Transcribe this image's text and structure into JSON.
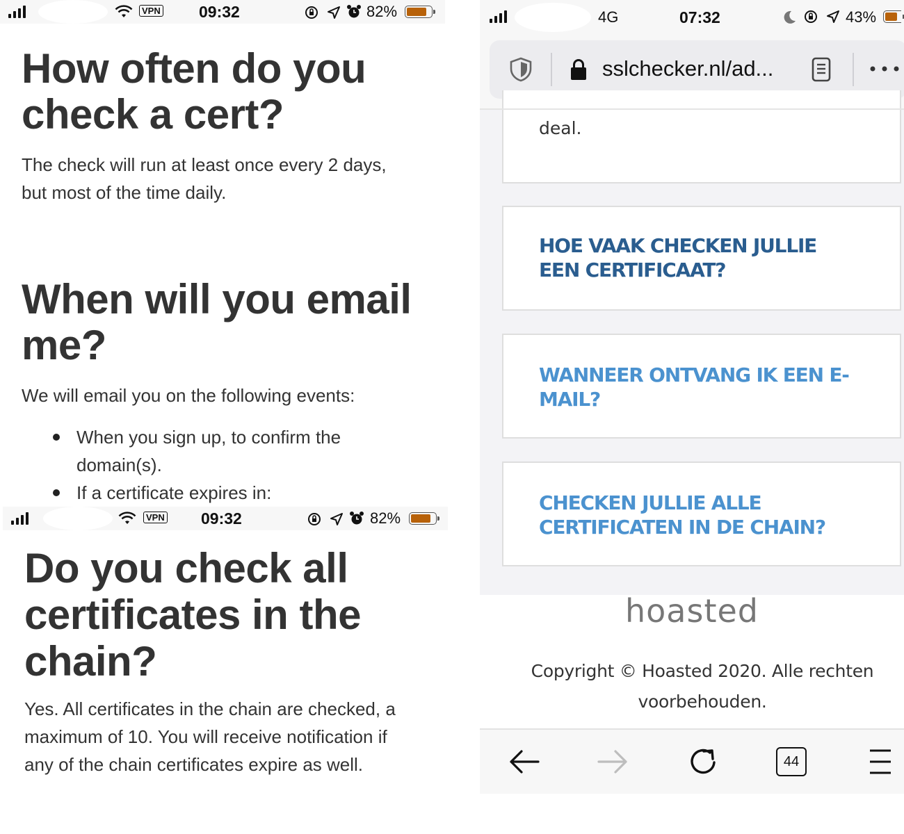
{
  "status_bar_top_left": {
    "time": "09:32",
    "vpn": "VPN",
    "battery": "82%",
    "battery_level": 0.82
  },
  "status_bar_bottom_left": {
    "time": "09:32",
    "vpn": "VPN",
    "battery": "82%",
    "battery_level": 0.82
  },
  "status_bar_right": {
    "network": "4G",
    "time": "07:32",
    "battery": "43%",
    "battery_level": 0.43
  },
  "doc": {
    "section1": {
      "title_line1": "How often do you",
      "title_line2": "check a cert?",
      "body_line1": "The check will run at least once every 2 days,",
      "body_line2": "but most of the time daily."
    },
    "section2": {
      "title_line1": "When will you email",
      "title_line2": "me?",
      "intro": "We will email you on the following events:",
      "items": [
        {
          "line1": "When you sign up, to confirm the",
          "line2": "domain(s)."
        },
        {
          "line1": "If a certificate expires in:"
        }
      ]
    },
    "section3": {
      "title_line1": "Do you check all",
      "title_line2": "certificates in the",
      "title_line3": "chain?",
      "body_line1": "Yes. All certificates in the chain are checked, a",
      "body_line2": "maximum of 10. You will receive notification if",
      "body_line3": "any of the chain certificates expire as well."
    }
  },
  "browser": {
    "url": "sslchecker.nl/ad...",
    "partial_card_text": "deal.",
    "faq": [
      {
        "line1": "HOE VAAK CHECKEN JULLIE",
        "line2": "EEN CERTIFICAAT?",
        "color": "#2a5d8f"
      },
      {
        "line1": "WANNEER ONTVANG IK EEN E-",
        "line2": "MAIL?",
        "color": "#4b92cf"
      },
      {
        "line1": "CHECKEN JULLIE ALLE",
        "line2": "CERTIFICATEN IN DE CHAIN?",
        "color": "#4b92cf"
      }
    ],
    "footer_logo": "hoasted",
    "copyright_line1": "Copyright © Hoasted 2020. Alle rechten",
    "copyright_line2": "voorbehouden.",
    "tabs_count": "44",
    "icons": [
      "shield-icon",
      "lock-icon",
      "reader-view-icon",
      "more-icon",
      "back-arrow-icon",
      "forward-arrow-icon",
      "reload-icon",
      "tabs-counter-icon",
      "menu-icon"
    ]
  }
}
